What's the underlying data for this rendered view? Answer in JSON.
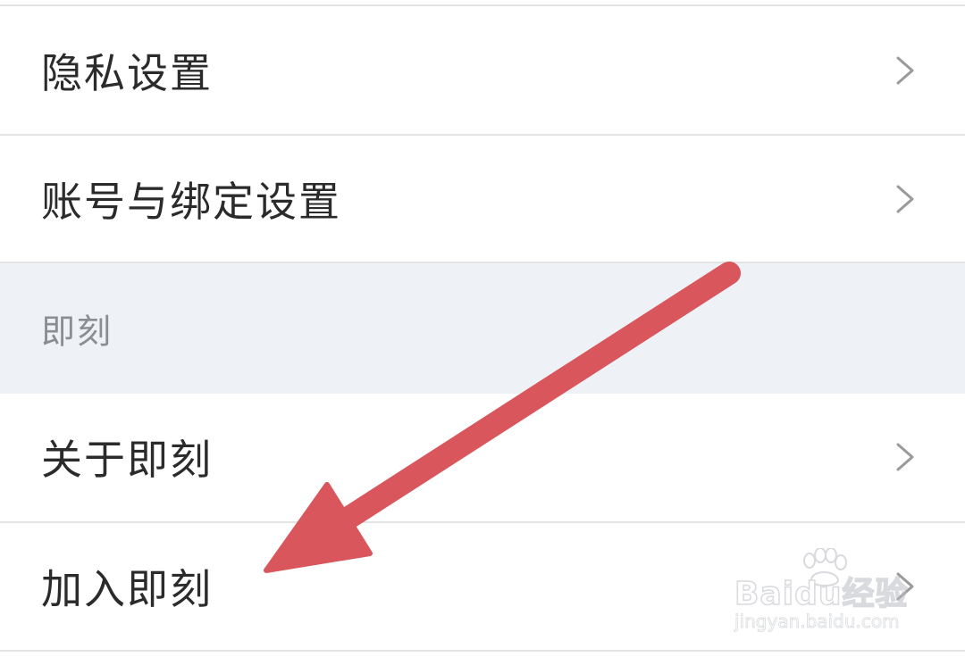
{
  "settings": {
    "items_top": [
      {
        "label": "隐私设置"
      },
      {
        "label": "账号与绑定设置"
      }
    ],
    "section": {
      "title": "即刻"
    },
    "items_bottom": [
      {
        "label": "关于即刻"
      },
      {
        "label": "加入即刻"
      }
    ]
  },
  "icons": {
    "chevron": "chevron-right-icon"
  },
  "annotation": {
    "arrow_color": "#d9565c"
  },
  "watermark": {
    "logo_text": "Baidu经验",
    "url": "jingyan.baidu.com"
  },
  "colors": {
    "section_bg": "#eef1f5",
    "divider": "#e4e4e4",
    "label_text": "#2b2b2b",
    "section_text": "#8a8d92"
  }
}
